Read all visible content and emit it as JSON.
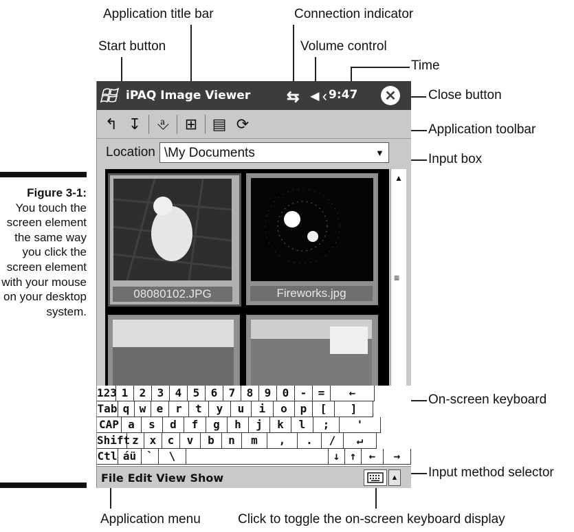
{
  "callouts": {
    "application_title_bar": "Application title bar",
    "connection_indicator": "Connection indicator",
    "start_button": "Start button",
    "volume_control": "Volume control",
    "time": "Time",
    "close_button": "Close button",
    "application_toolbar": "Application toolbar",
    "input_box": "Input box",
    "on_screen_keyboard": "On-screen keyboard",
    "input_method_selector": "Input method selector",
    "application_menu": "Application menu",
    "toggle_keyboard": "Click to toggle the on-screen keyboard display"
  },
  "caption": {
    "number": "Figure 3-1:",
    "text": "You touch the screen element the same way you click the screen element with your mouse on your desktop system."
  },
  "device": {
    "title": "iPAQ Image Viewer",
    "time": "9:47",
    "location_label": "Location",
    "location_value": "\\My Documents",
    "thumbnails": [
      {
        "name": "08080102.JPG",
        "selected": true
      },
      {
        "name": "Fireworks.jpg",
        "selected": false
      },
      {
        "name": "",
        "selected": false
      },
      {
        "name": "",
        "selected": false
      }
    ],
    "keyboard_rows": [
      [
        "123",
        "1",
        "2",
        "3",
        "4",
        "5",
        "6",
        "7",
        "8",
        "9",
        "0",
        "-",
        "=",
        "←"
      ],
      [
        "Tab",
        "q",
        "w",
        "e",
        "r",
        "t",
        "y",
        "u",
        "i",
        "o",
        "p",
        "[",
        "]"
      ],
      [
        "CAP",
        "a",
        "s",
        "d",
        "f",
        "g",
        "h",
        "j",
        "k",
        "l",
        ";",
        "'"
      ],
      [
        "Shift",
        "z",
        "x",
        "c",
        "v",
        "b",
        "n",
        "m",
        ",",
        ".",
        "/",
        "↵"
      ],
      [
        "Ctl",
        "áü",
        "`",
        "\\",
        "",
        "↓",
        "↑",
        "←",
        "→"
      ]
    ],
    "menu": [
      "File",
      "Edit",
      "View",
      "Show"
    ]
  }
}
